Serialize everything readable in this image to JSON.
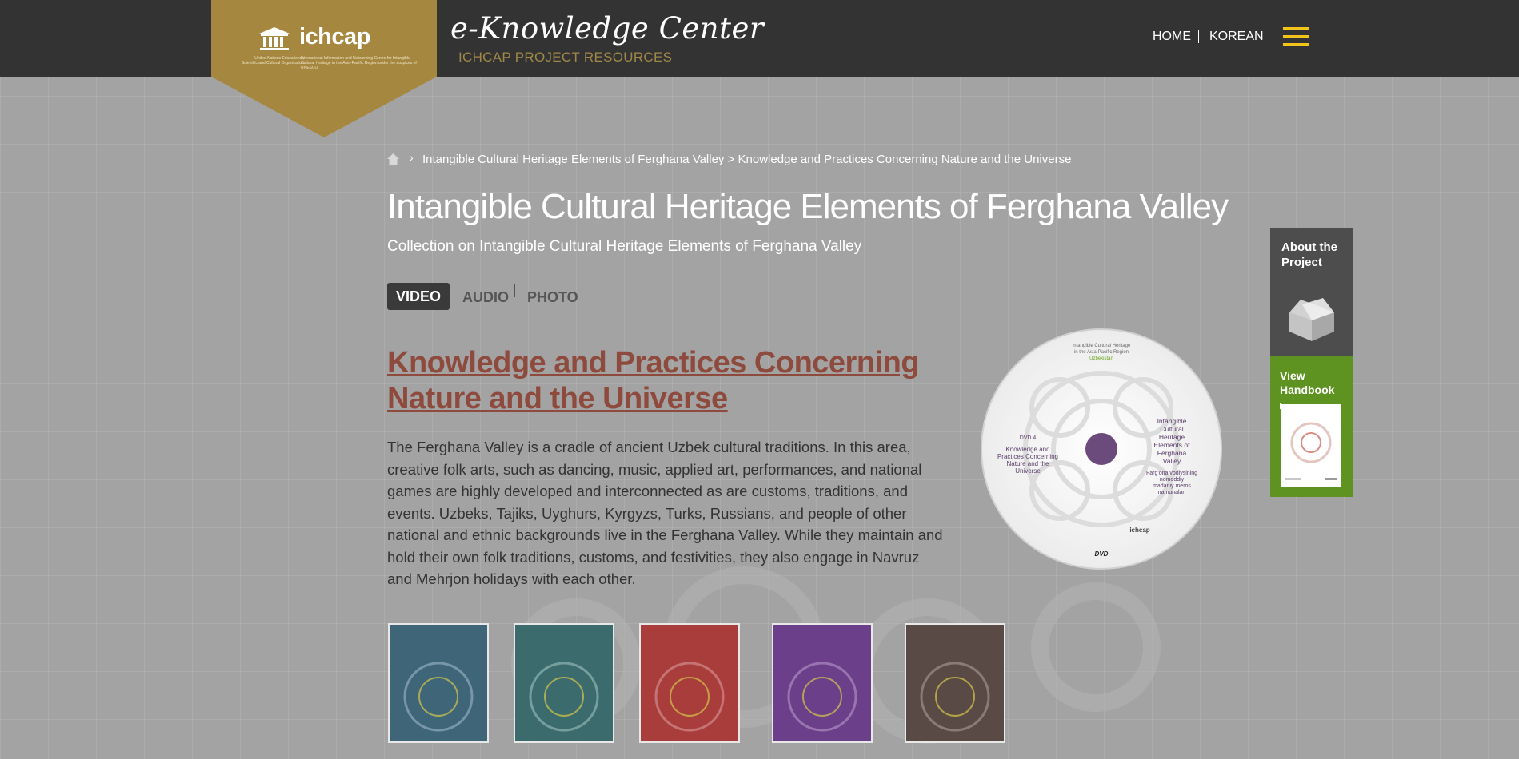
{
  "header": {
    "logo_name": "ichcap",
    "logo_org_unesco": "United Nations Educational, Scientific and Cultural Organization",
    "logo_org_ichcap": "International Information and Networking Centre for Intangible Cultural Heritage in the Asia-Pacific Region under the auspices of UNESCO",
    "site_title": "e-Knowledge Center",
    "site_subtitle": "ICHCAP PROJECT RESOURCES",
    "nav_home": "HOME",
    "nav_korean": "KOREAN",
    "menu_icon": "hamburger-menu-icon",
    "accent_color": "#f2c318",
    "badge_color": "#a5873f"
  },
  "breadcrumb": {
    "home_icon": "home-icon",
    "path": "Intangible Cultural Heritage Elements of Ferghana Valley > Knowledge and Practices Concerning Nature and the Universe"
  },
  "page": {
    "title": "Intangible Cultural Heritage Elements of Ferghana Valley",
    "subtitle": "Collection on Intangible Cultural Heritage Elements of Ferghana Valley"
  },
  "tabs": {
    "video": "VIDEO",
    "audio": "AUDIO",
    "photo": "PHOTO",
    "active": "VIDEO"
  },
  "item": {
    "title": "Knowledge and Practices Concerning Nature and the Universe",
    "description": "The Ferghana Valley is a cradle of ancient Uzbek cultural traditions. In this area, creative folk arts, such as dancing, music, applied art, performances, and national games are highly developed and interconnected as are customs, traditions, and events. Uzbeks, Tajiks, Uyghurs, Kyrgyzs, Turks, Russians, and people of other national and ethnic backgrounds live in the Ferghana Valley. While they maintain and hold their own folk traditions, customs, and festivities, they also engage in Navruz and Mehrjon holidays with each other.",
    "title_color": "#8e4a3c"
  },
  "dvd": {
    "header_line1": "Intangible Cultural Heritage",
    "header_line2": "in the Asia-Pacific Region",
    "header_tag": "Uzbekistan",
    "disc_label": "DVD 4",
    "left_text_1": "Knowledge and",
    "left_text_2": "Practices Concerning",
    "left_text_3": "Nature and the",
    "left_text_4": "Universe",
    "right_text_1": "Intangible",
    "right_text_2": "Cultural",
    "right_text_3": "Heritage",
    "right_text_4": "Elements of",
    "right_text_5": "Ferghana",
    "right_text_6": "Valley",
    "right_uz_1": "Farg'ona vodiysining",
    "right_uz_2": "nomoddiy",
    "right_uz_3": "madaniy meros",
    "right_uz_4": "namunalari",
    "footer_logo": "ichcap",
    "format": "DVD",
    "hub_color": "#6b4a7c"
  },
  "thumbnails": [
    {
      "color": "#3e6578"
    },
    {
      "color": "#3c6b6e"
    },
    {
      "color": "#a83d3c"
    },
    {
      "color": "#6b3f8a"
    },
    {
      "color": "#5a4a45"
    }
  ],
  "sidebar": {
    "about_label": "About the Project",
    "about_icon": "box-icon",
    "handbook_label": "View Handbook",
    "handbook_arrow_icon": "arrow-right-icon"
  }
}
